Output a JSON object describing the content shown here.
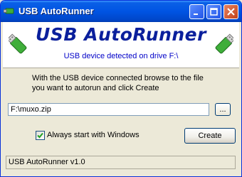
{
  "window": {
    "title": "USB AutoRunner",
    "icon": "usb-drive-icon",
    "controls": [
      "minimize-icon",
      "maximize-icon",
      "close-icon"
    ]
  },
  "header": {
    "app_name": "USB AutoRunner",
    "detected_message": "USB device detected on drive F:\\",
    "left_icon": "usb-drive-icon",
    "right_icon": "usb-drive-icon"
  },
  "instructions": "With the USB device connected browse to the file you want to autorun and click Create",
  "file_input": {
    "value": "F:\\muxo.zip"
  },
  "browse_button": {
    "label": "..."
  },
  "checkbox": {
    "label": "Always start with Windows",
    "checked": true
  },
  "create_button": {
    "label": "Create"
  },
  "status_bar": {
    "text": "USB AutoRunner v1.0"
  },
  "colors": {
    "titlebar": "#0054e3",
    "app_title": "#0a1f9c",
    "detected_text": "#0000c8",
    "window_bg": "#ece9d8",
    "usb_green": "#3fae3a"
  }
}
